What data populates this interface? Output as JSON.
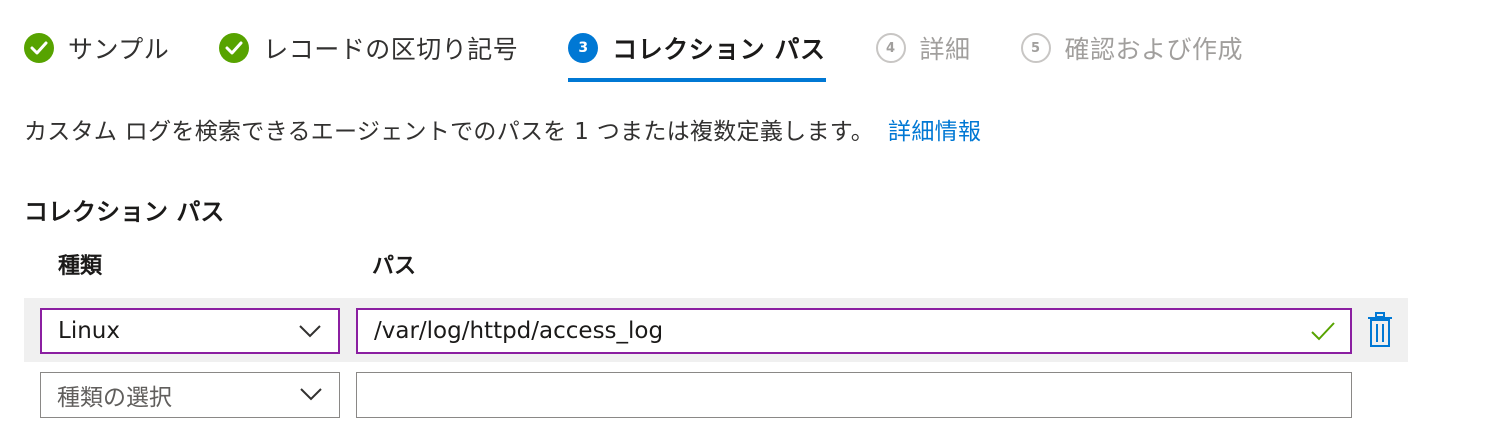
{
  "wizard": {
    "steps": [
      {
        "label": "サンプル",
        "status": "done"
      },
      {
        "label": "レコードの区切り記号",
        "status": "done"
      },
      {
        "label": "コレクション パス",
        "number": "3",
        "status": "current"
      },
      {
        "label": "詳細",
        "number": "4",
        "status": "future"
      },
      {
        "label": "確認および作成",
        "number": "5",
        "status": "future"
      }
    ]
  },
  "description": {
    "text": "カスタム ログを検索できるエージェントでのパスを 1 つまたは複数定義します。",
    "link": "詳細情報"
  },
  "section": {
    "title": "コレクション パス",
    "col_type": "種類",
    "col_path": "パス"
  },
  "rows": [
    {
      "type": "Linux",
      "path": "/var/log/httpd/access_log"
    },
    {
      "type_placeholder": "種類の選択",
      "path": ""
    }
  ],
  "colors": {
    "accent": "#0078d4",
    "done": "#57a300",
    "active_border": "#8b1fa1"
  }
}
